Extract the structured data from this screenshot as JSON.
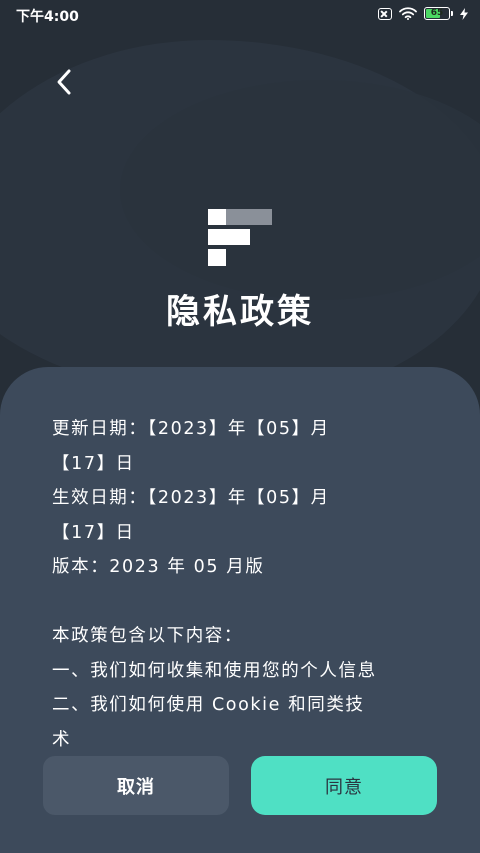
{
  "status_bar": {
    "time": "下午4:00",
    "battery_level": "65",
    "battery_fraction": 0.65,
    "icons": [
      "sim-off-icon",
      "wifi-icon",
      "battery-icon",
      "charging-icon"
    ]
  },
  "header": {
    "back_icon": "chevron-left-icon",
    "logo": "app-logo",
    "title": "隐私政策"
  },
  "policy": {
    "lines": [
      "更新日期：【2023】年【05】月",
      "【17】日",
      "生效日期：【2023】年【05】月",
      "【17】日",
      "版本：2023 年 05 月版",
      "",
      "本政策包含以下内容：",
      "一、我们如何收集和使用您的个人信息",
      "二、我们如何使用 Cookie 和同类技",
      "术"
    ]
  },
  "actions": {
    "cancel_label": "取消",
    "agree_label": "同意"
  },
  "colors": {
    "background": "#262e37",
    "card": "#3d4a5b",
    "cancel_button": "#4b5869",
    "agree_button": "#4fe0c4",
    "battery": "#4cd964",
    "logo_gray": "#8a9099"
  }
}
